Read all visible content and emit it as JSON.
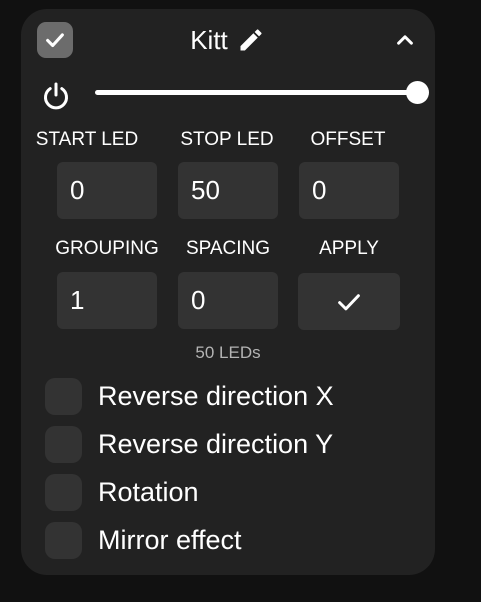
{
  "segment": {
    "name": "Kitt",
    "selected": true,
    "expanded": true,
    "power_on": true,
    "brightness_fraction": 1.0
  },
  "fields": {
    "start_led": {
      "label": "START LED",
      "value": "0"
    },
    "stop_led": {
      "label": "STOP LED",
      "value": "50"
    },
    "offset": {
      "label": "OFFSET",
      "value": "0"
    },
    "grouping": {
      "label": "GROUPING",
      "value": "1"
    },
    "spacing": {
      "label": "SPACING",
      "value": "0"
    },
    "apply": {
      "label": "APPLY"
    }
  },
  "led_count_text": "50 LEDs",
  "options": [
    {
      "label": "Reverse direction X",
      "checked": false
    },
    {
      "label": "Reverse direction Y",
      "checked": false
    },
    {
      "label": "Rotation",
      "checked": false
    },
    {
      "label": "Mirror effect",
      "checked": false
    }
  ],
  "icons": {
    "select": "check-icon",
    "edit": "pencil-icon",
    "collapse": "chevron-up-icon",
    "power": "power-icon",
    "apply": "check-icon"
  },
  "colors": {
    "page_background": "#111111",
    "card_background": "#222222",
    "field_background": "#333333",
    "select_box": "#6c6c6c",
    "muted_text": "#b4b4b4",
    "text": "#ffffff"
  }
}
